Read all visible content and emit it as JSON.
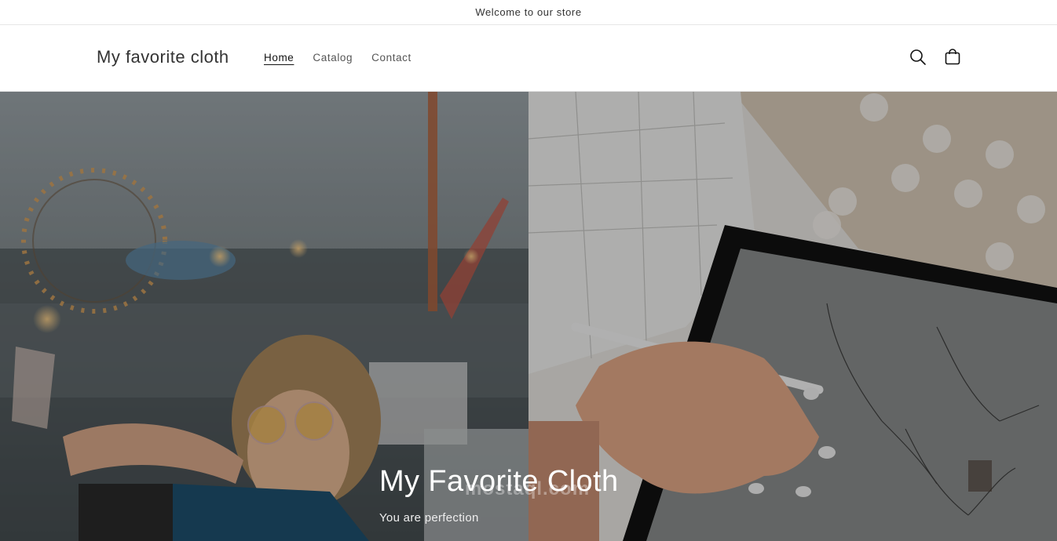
{
  "announcement": {
    "text": "Welcome to our store"
  },
  "header": {
    "logo": "My favorite cloth",
    "nav": [
      {
        "label": "Home",
        "active": true
      },
      {
        "label": "Catalog",
        "active": false
      },
      {
        "label": "Contact",
        "active": false
      }
    ],
    "icons": {
      "search": "search-icon",
      "cart": "cart-icon"
    }
  },
  "hero": {
    "title": "My Favorite Cloth",
    "subtitle": "You are perfection",
    "left_image": "woman-at-fair-photo",
    "right_image": "tablet-fashion-sketch-photo"
  },
  "watermark": {
    "text": "mostaql.com"
  }
}
